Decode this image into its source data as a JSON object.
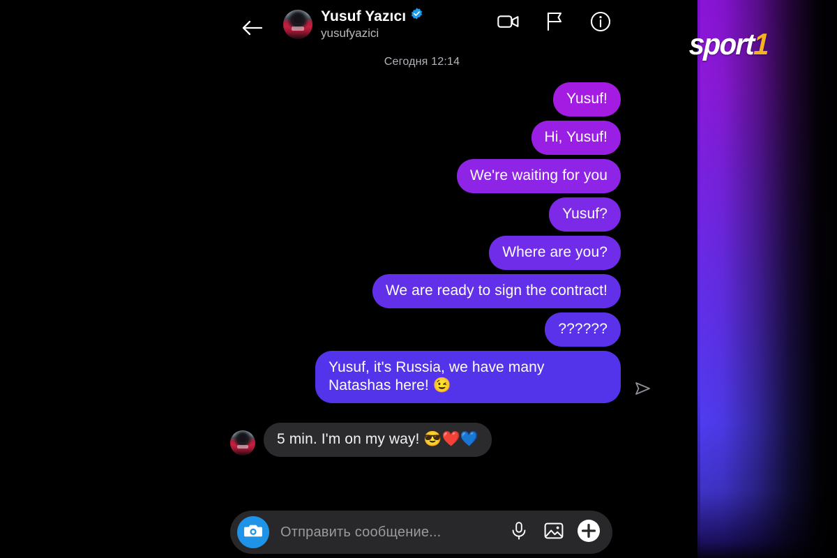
{
  "brand": {
    "logo_text": "sport",
    "logo_accent": "1",
    "accent_color": "#f5b323",
    "band_top_color": "#8a14d8",
    "band_bottom_color": "#4f3cf0"
  },
  "header": {
    "back_icon": "back-arrow-icon",
    "avatar": "profile-avatar",
    "title": "Yusuf Yazıcı",
    "verified_icon": "verified-badge-icon",
    "handle": "yusufyazici",
    "actions": [
      {
        "name": "video-call-button",
        "icon": "video-camera-icon"
      },
      {
        "name": "flag-button",
        "icon": "flag-icon"
      },
      {
        "name": "info-button",
        "icon": "info-circle-icon"
      }
    ]
  },
  "conversation": {
    "day_stamp": "Сегодня 12:14",
    "messages": [
      {
        "text": "Yusuf!",
        "dir": "out",
        "color": "#a41ce2"
      },
      {
        "text": "Hi, Yusuf!",
        "dir": "out",
        "color": "#9a1fe4"
      },
      {
        "text": "We're waiting for you",
        "dir": "out",
        "color": "#8d24e6"
      },
      {
        "text": "Yusuf?",
        "dir": "out",
        "color": "#7c29e8"
      },
      {
        "text": "Where are you?",
        "dir": "out",
        "color": "#6f2de9"
      },
      {
        "text": "We are ready to sign the contract!",
        "dir": "out",
        "color": "#6330ea"
      },
      {
        "text": "??????",
        "dir": "out",
        "color": "#5a32ea"
      },
      {
        "text": "Yusuf, it's Russia, we have many Natashas here! 😉",
        "dir": "out",
        "color": "#5434ea"
      },
      {
        "text": "5 min. I'm on my way! 😎❤️💙",
        "dir": "in",
        "color": "#2b2b2d"
      }
    ],
    "send_status_icon": "send-arrow-icon"
  },
  "composer": {
    "camera_icon": "camera-icon",
    "placeholder": "Отправить сообщение...",
    "value": "",
    "mic_icon": "microphone-icon",
    "gallery_icon": "image-icon",
    "plus_icon": "plus-circle-icon"
  }
}
